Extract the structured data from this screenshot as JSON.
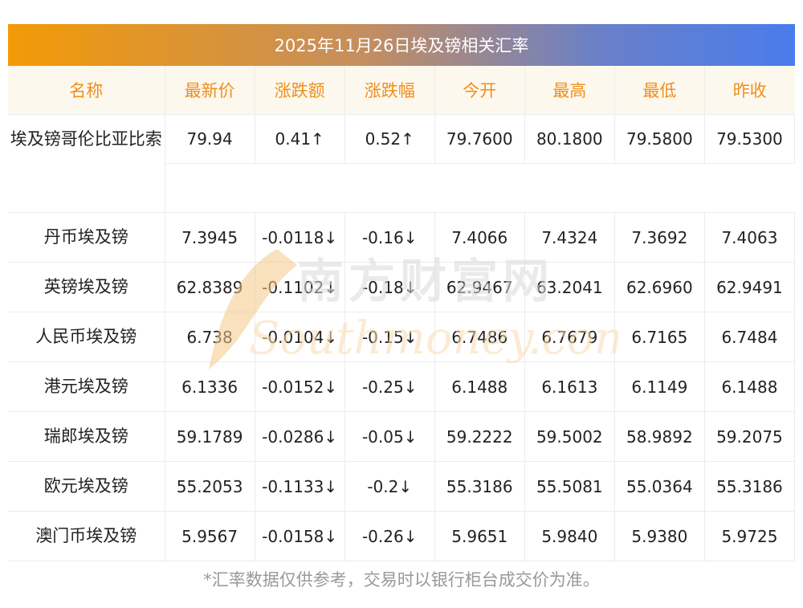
{
  "title": "2025年11月26日埃及镑相关汇率",
  "columns": [
    "名称",
    "最新价",
    "涨跌额",
    "涨跌幅",
    "今开",
    "最高",
    "最低",
    "昨收"
  ],
  "rows": [
    {
      "name": "埃及镑哥伦比亚比索",
      "latest": "79.94",
      "change": "0.41↑",
      "pct": "0.52↑",
      "open": "79.7600",
      "high": "80.1800",
      "low": "79.5800",
      "prev": "79.5300",
      "dir": "up"
    },
    {
      "name": "丹币埃及镑",
      "latest": "7.3945",
      "change": "-0.0118↓",
      "pct": "-0.16↓",
      "open": "7.4066",
      "high": "7.4324",
      "low": "7.3692",
      "prev": "7.4063",
      "dir": "down"
    },
    {
      "name": "英镑埃及镑",
      "latest": "62.8389",
      "change": "-0.1102↓",
      "pct": "-0.18↓",
      "open": "62.9467",
      "high": "63.2041",
      "low": "62.6960",
      "prev": "62.9491",
      "dir": "down"
    },
    {
      "name": "人民币埃及镑",
      "latest": "6.738",
      "change": "-0.0104↓",
      "pct": "-0.15↓",
      "open": "6.7486",
      "high": "6.7679",
      "low": "6.7165",
      "prev": "6.7484",
      "dir": "down"
    },
    {
      "name": "港元埃及镑",
      "latest": "6.1336",
      "change": "-0.0152↓",
      "pct": "-0.25↓",
      "open": "6.1488",
      "high": "6.1613",
      "low": "6.1149",
      "prev": "6.1488",
      "dir": "down"
    },
    {
      "name": "瑞郎埃及镑",
      "latest": "59.1789",
      "change": "-0.0286↓",
      "pct": "-0.05↓",
      "open": "59.2222",
      "high": "59.5002",
      "low": "58.9892",
      "prev": "59.2075",
      "dir": "down"
    },
    {
      "name": "欧元埃及镑",
      "latest": "55.2053",
      "change": "-0.1133↓",
      "pct": "-0.2↓",
      "open": "55.3186",
      "high": "55.5081",
      "low": "55.0364",
      "prev": "55.3186",
      "dir": "down"
    },
    {
      "name": "澳门币埃及镑",
      "latest": "5.9567",
      "change": "-0.0158↓",
      "pct": "-0.26↓",
      "open": "5.9651",
      "high": "5.9840",
      "low": "5.9380",
      "prev": "5.9725",
      "dir": "down"
    }
  ],
  "watermark": {
    "cn": "南方财富网",
    "en": "Southmoney.com"
  },
  "footnote": "*汇率数据仅供参考，交易时以银行柜台成交价为准。",
  "colors": {
    "up": "#e41b1b",
    "down": "#1f8a1f",
    "header_text": "#f08e1c",
    "header_bg": "#fdf8ee"
  }
}
